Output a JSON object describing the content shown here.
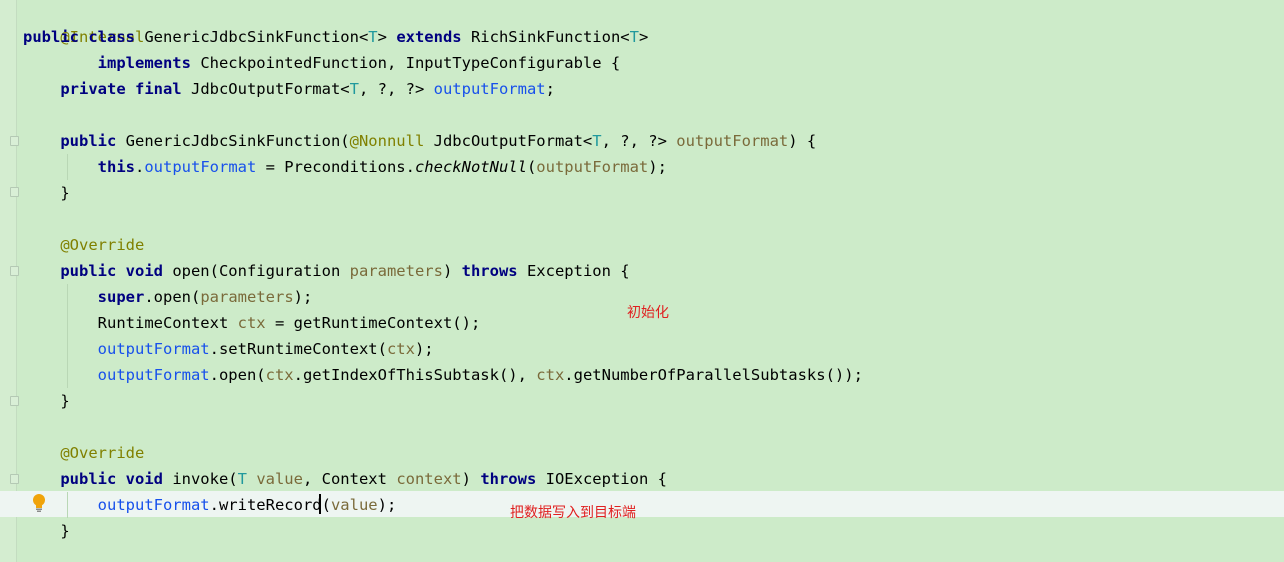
{
  "code": {
    "l1": "@Internal",
    "l2a": "public class ",
    "l2b": "GenericJdbcSinkFunction<",
    "l2c": "T",
    "l2d": "> ",
    "l2e": "extends ",
    "l2f": "RichSinkFunction<",
    "l2g": "T",
    "l2h": ">",
    "l3a": "        implements ",
    "l3b": "CheckpointedFunction, InputTypeConfigurable {",
    "l4a": "    private final ",
    "l4b": "JdbcOutputFormat<",
    "l4c": "T",
    "l4d": ", ?, ?> ",
    "l4e": "outputFormat",
    "l4f": ";",
    "l6a": "    public ",
    "l6b": "GenericJdbcSinkFunction(",
    "l6c": "@Nonnull ",
    "l6d": "JdbcOutputFormat<",
    "l6e": "T",
    "l6f": ", ?, ?> ",
    "l6g": "outputFormat",
    "l6h": ") {",
    "l7a": "        this",
    "l7b": ".",
    "l7c": "outputFormat",
    "l7d": " = Preconditions.",
    "l7e": "checkNotNull",
    "l7f": "(",
    "l7g": "outputFormat",
    "l7h": ");",
    "l8": "    }",
    "l10": "    @Override",
    "l11a": "    public void ",
    "l11b": "open(Configuration ",
    "l11c": "parameters",
    "l11d": ") ",
    "l11e": "throws ",
    "l11f": "Exception {",
    "l12a": "        super",
    "l12b": ".open(",
    "l12c": "parameters",
    "l12d": ");",
    "l13a": "        RuntimeContext ",
    "l13b": "ctx",
    "l13c": " = getRuntimeContext();",
    "l14a": "        ",
    "l14b": "outputFormat",
    "l14c": ".setRuntimeContext(",
    "l14d": "ctx",
    "l14e": ");",
    "l15a": "        ",
    "l15b": "outputFormat",
    "l15c": ".open(",
    "l15d": "ctx",
    "l15e": ".getIndexOfThisSubtask(), ",
    "l15f": "ctx",
    "l15g": ".getNumberOfParallelSubtasks());",
    "l16": "    }",
    "l18": "    @Override",
    "l19a": "    public void ",
    "l19b": "invoke(",
    "l19c": "T ",
    "l19d": "value",
    "l19e": ", Context ",
    "l19f": "context",
    "l19g": ") ",
    "l19h": "throws ",
    "l19i": "IOException {",
    "l20a": "        ",
    "l20b": "outputFormat",
    "l20c": ".writeRecord(",
    "l20d": "value",
    "l20e": ");",
    "l21": "    }"
  },
  "annotations": {
    "init": "初始化",
    "write": "把数据写入到目标端"
  },
  "icons": {
    "bulb": "lightbulb-icon",
    "fold": "fold-marker-icon"
  },
  "colors": {
    "background": "#cdebc9",
    "keyword": "#000080",
    "field": "#1750eb",
    "annotation_text": "#e02020"
  }
}
